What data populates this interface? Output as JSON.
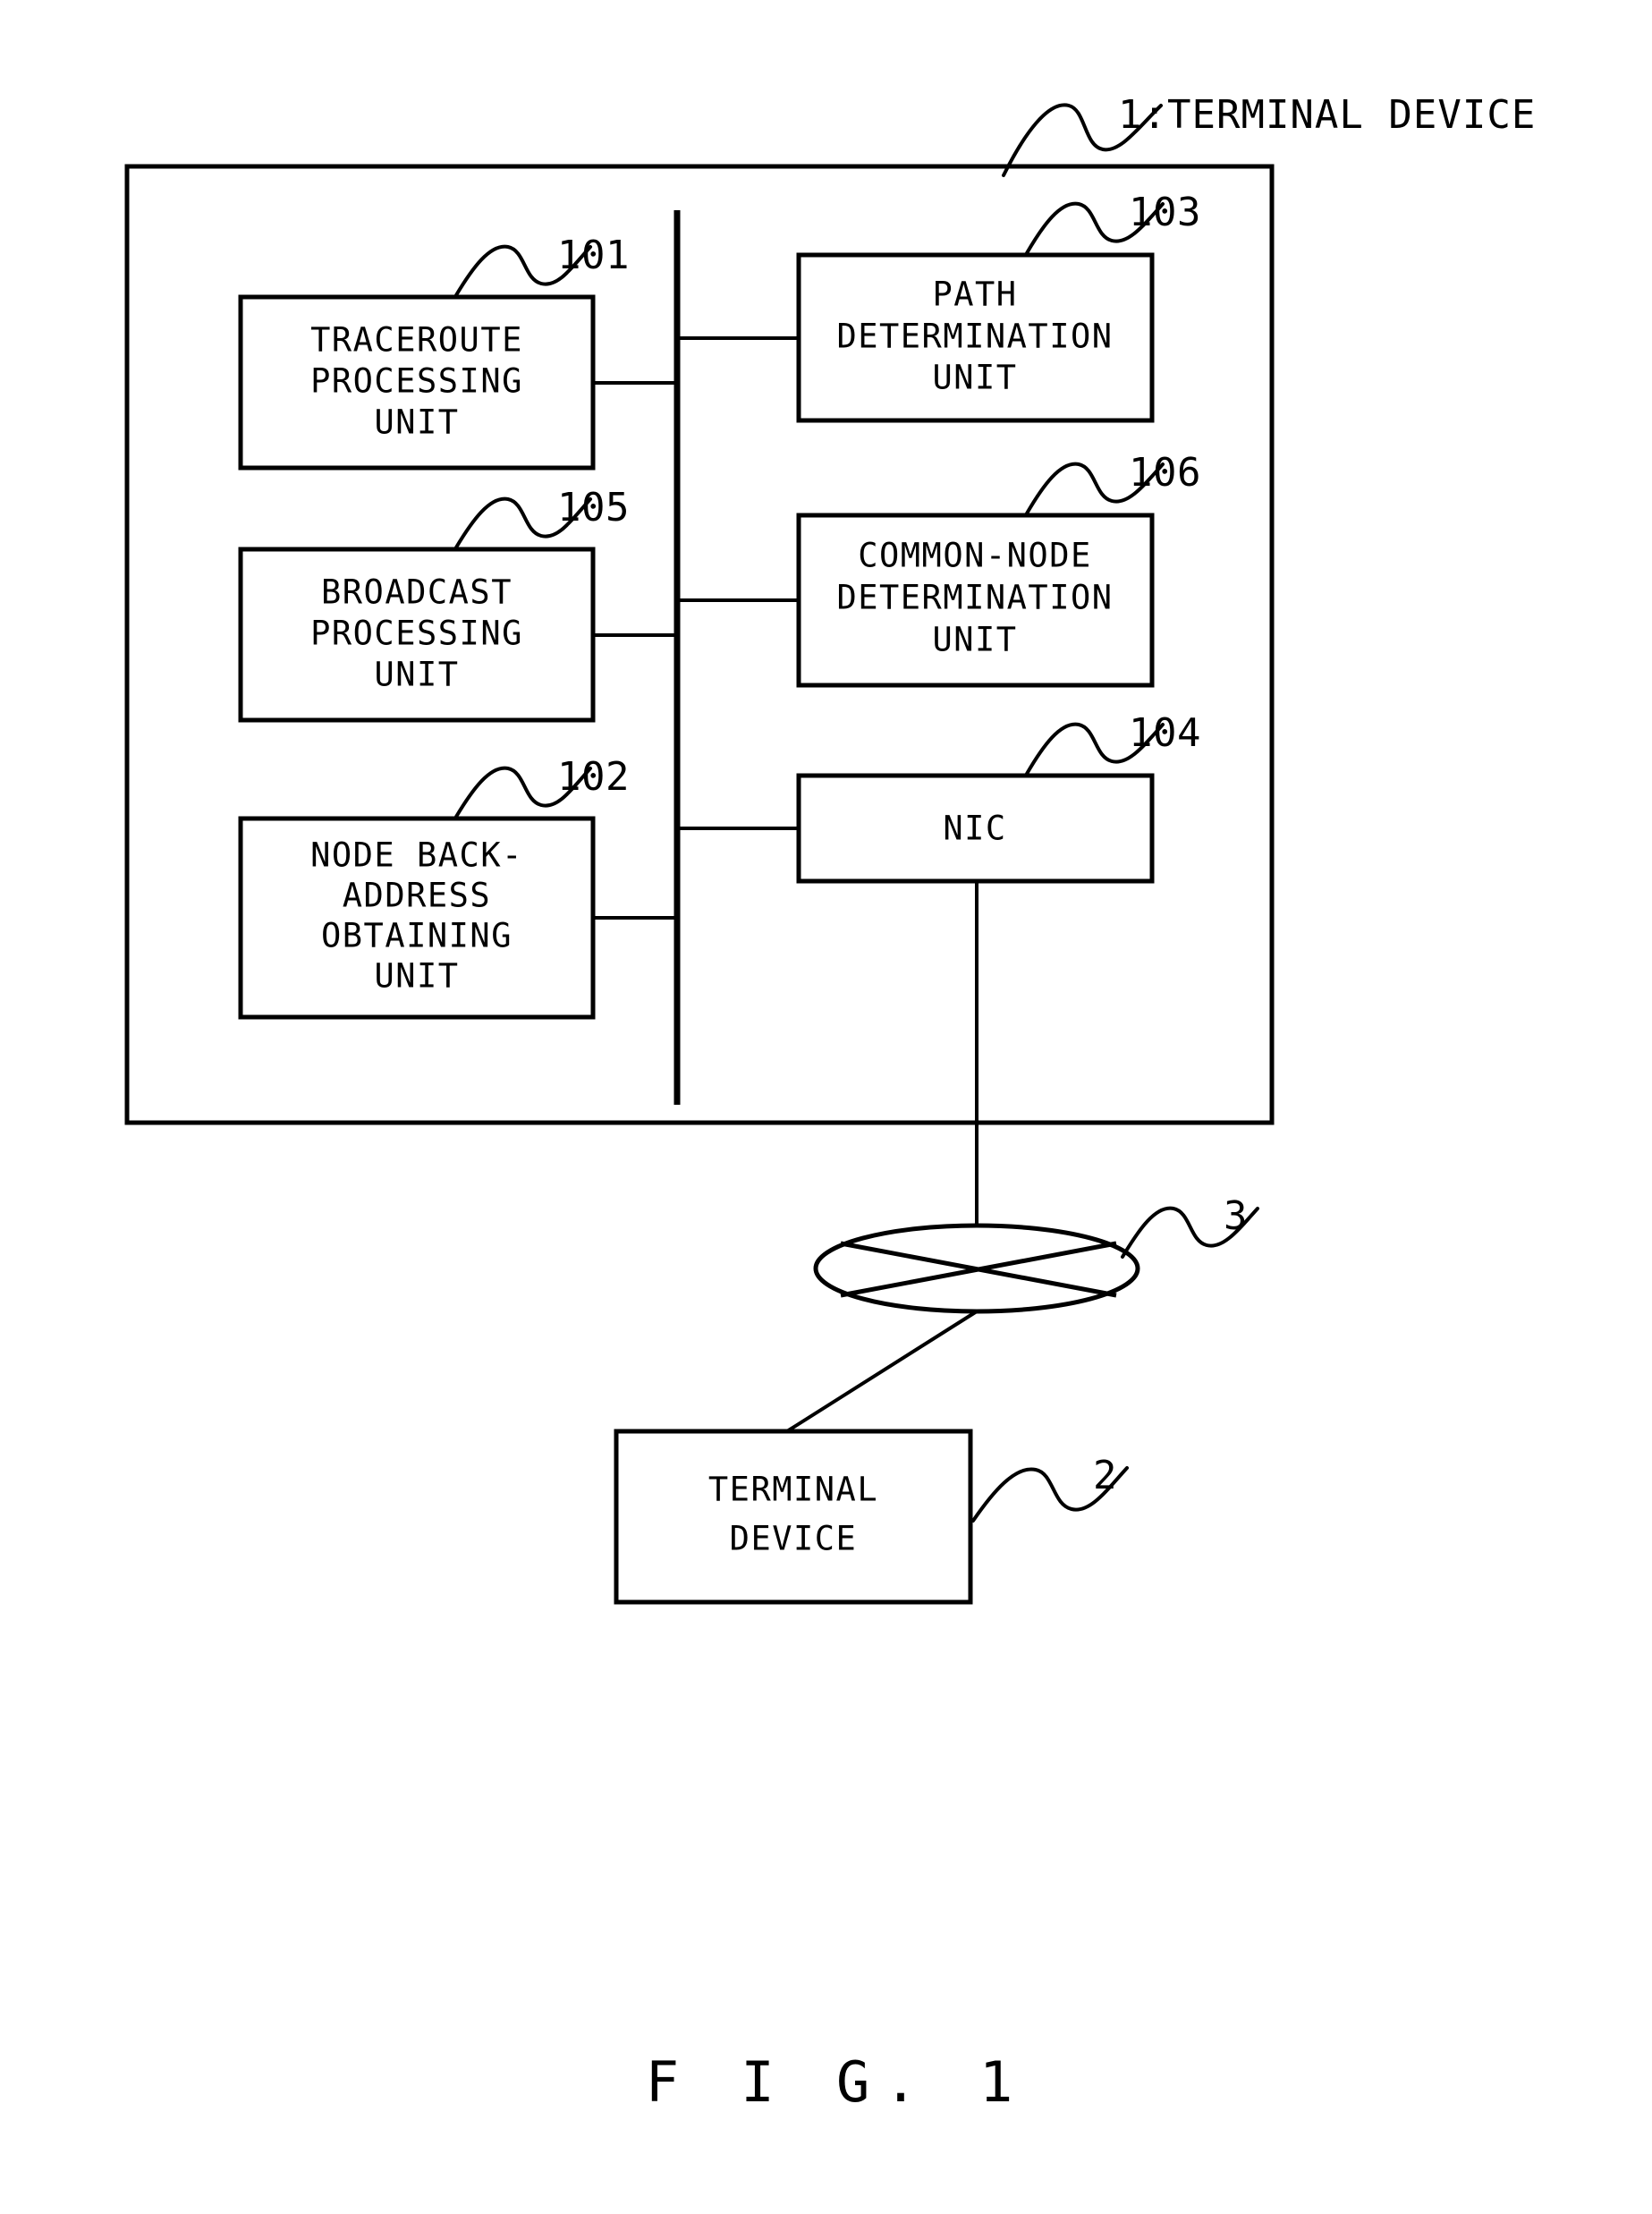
{
  "figure": {
    "caption": "F I G.  1",
    "title_ref": "1:TERMINAL DEVICE"
  },
  "device": {
    "frame_name": "terminal-device-1",
    "ref": "1",
    "label": "TERMINAL DEVICE"
  },
  "units": [
    {
      "id": "traceroute-processing-unit",
      "ref": "101",
      "lines": [
        "TRACEROUTE",
        "PROCESSING",
        "UNIT"
      ],
      "column": "left"
    },
    {
      "id": "broadcast-processing-unit",
      "ref": "105",
      "lines": [
        "BROADCAST",
        "PROCESSING",
        "UNIT"
      ],
      "column": "left"
    },
    {
      "id": "node-back-address-obtaining-unit",
      "ref": "102",
      "lines": [
        "NODE BACK-",
        "ADDRESS",
        "OBTAINING",
        "UNIT"
      ],
      "column": "left"
    },
    {
      "id": "path-determination-unit",
      "ref": "103",
      "lines": [
        "PATH",
        "DETERMINATION",
        "UNIT"
      ],
      "column": "right"
    },
    {
      "id": "common-node-determination-unit",
      "ref": "106",
      "lines": [
        "COMMON-NODE",
        "DETERMINATION",
        "UNIT"
      ],
      "column": "right"
    },
    {
      "id": "nic",
      "ref": "104",
      "lines": [
        "NIC"
      ],
      "column": "right"
    }
  ],
  "network": {
    "id": "network-cloud",
    "ref": "3",
    "label": ""
  },
  "remote_terminal": {
    "id": "terminal-device-2",
    "ref": "2",
    "lines": [
      "TERMINAL",
      "DEVICE"
    ]
  },
  "colors": {
    "ink": "#000000",
    "paper": "#ffffff"
  }
}
